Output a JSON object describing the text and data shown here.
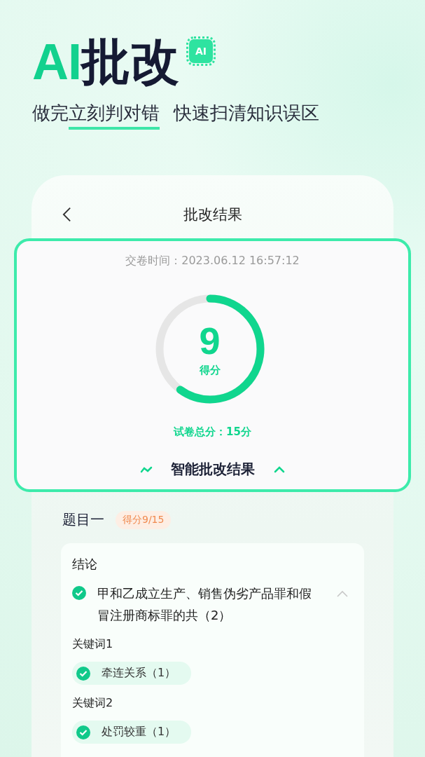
{
  "promo": {
    "title_accent": "AI",
    "title_main": "批改",
    "chip_label": "AI",
    "subtitle_parts": [
      "做完",
      "立刻判对错",
      "快速扫清知识误区"
    ]
  },
  "nav": {
    "title": "批改结果"
  },
  "result": {
    "submit_time": "交卷时间：2023.06.12 16:57:12",
    "score": "9",
    "score_label": "得分",
    "level": 0.6,
    "total": "试卷总分：15分",
    "section_title": "智能批改结果"
  },
  "question": {
    "title": "题目一",
    "score_badge": "得分9/15",
    "groups": [
      {
        "label": "结论",
        "kind": "answer",
        "items": [
          {
            "text": "甲和乙成立生产、销售伪劣产品罪和假冒注册商标罪的共（2）",
            "correct": true,
            "expanded": true
          }
        ]
      },
      {
        "label": "关键词1",
        "kind": "keyword",
        "items": [
          {
            "text": "牵连关系（1）",
            "correct": true
          }
        ]
      },
      {
        "label": "关键词2",
        "kind": "keyword",
        "items": [
          {
            "text": "处罚较重（1）",
            "correct": true
          }
        ]
      }
    ]
  }
}
